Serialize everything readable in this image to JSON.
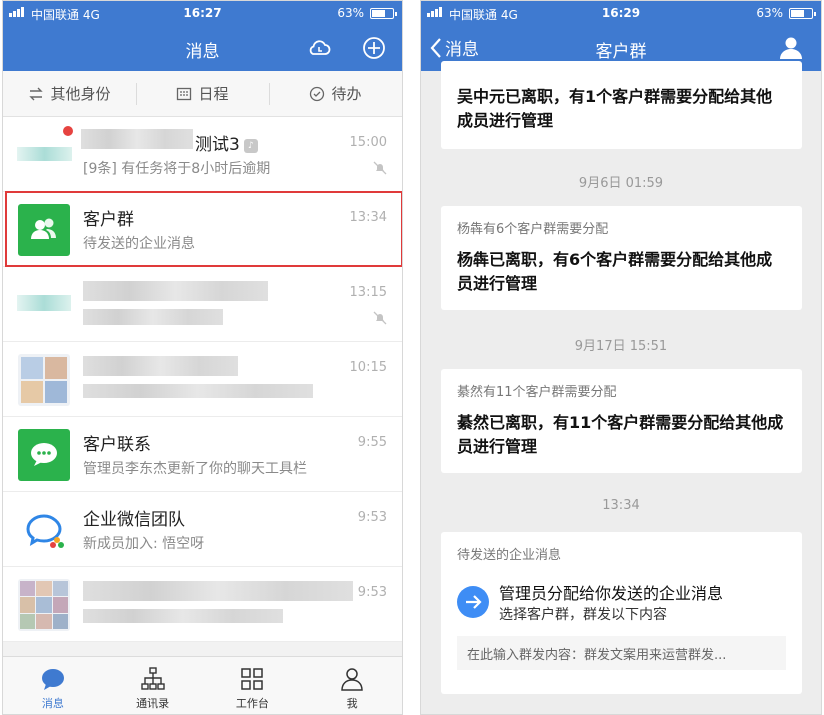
{
  "left": {
    "status": {
      "carrier": "中国联通",
      "network": "4G",
      "time": "16:27",
      "battery": "63%"
    },
    "nav": {
      "title": "消息"
    },
    "quickbar": [
      {
        "label": "其他身份"
      },
      {
        "label": "日程"
      },
      {
        "label": "待办"
      }
    ],
    "rows": [
      {
        "name": "测试3",
        "sub": "[9条] 有任务将于8小时后逾期",
        "time": "15:00"
      },
      {
        "name": "客户群",
        "sub": "待发送的企业消息",
        "time": "13:34"
      },
      {
        "name": "",
        "sub": "",
        "time": "13:15"
      },
      {
        "name": "",
        "sub": "",
        "time": "10:15"
      },
      {
        "name": "客户联系",
        "sub": "管理员李东杰更新了你的聊天工具栏",
        "time": "9:55"
      },
      {
        "name": "企业微信团队",
        "sub": "新成员加入: 悟空呀",
        "time": "9:53"
      },
      {
        "name": "",
        "sub": "",
        "time": "9:53"
      }
    ],
    "tabs": [
      {
        "label": "消息"
      },
      {
        "label": "通讯录"
      },
      {
        "label": "工作台"
      },
      {
        "label": "我"
      }
    ]
  },
  "right": {
    "status": {
      "carrier": "中国联通",
      "network": "4G",
      "time": "16:29",
      "battery": "63%"
    },
    "nav": {
      "back_label": "消息",
      "title": "客户群"
    },
    "card0": {
      "body": "吴中元已离职，有1个客户群需要分配给其他成员进行管理"
    },
    "stamp1": "9月6日 01:59",
    "card1": {
      "title": "杨犇有6个客户群需要分配",
      "body": "杨犇已离职，有6个客户群需要分配给其他成员进行管理"
    },
    "stamp2": "9月17日 15:51",
    "card2": {
      "title": "綦然有11个客户群需要分配",
      "body": "綦然已离职，有11个客户群需要分配给其他成员进行管理"
    },
    "stamp3": "13:34",
    "card3": {
      "title": "待发送的企业消息",
      "msg_title": "管理员分配给你发送的企业消息",
      "msg_sub": "选择客户群，群发以下内容",
      "input_text": "在此输入群发内容：群发文案用来运营群发..."
    }
  },
  "colors": {
    "brand": "#3f7ad0",
    "highlight": "#e03a3a",
    "green": "#2bb24c",
    "badge": "#e64340"
  }
}
